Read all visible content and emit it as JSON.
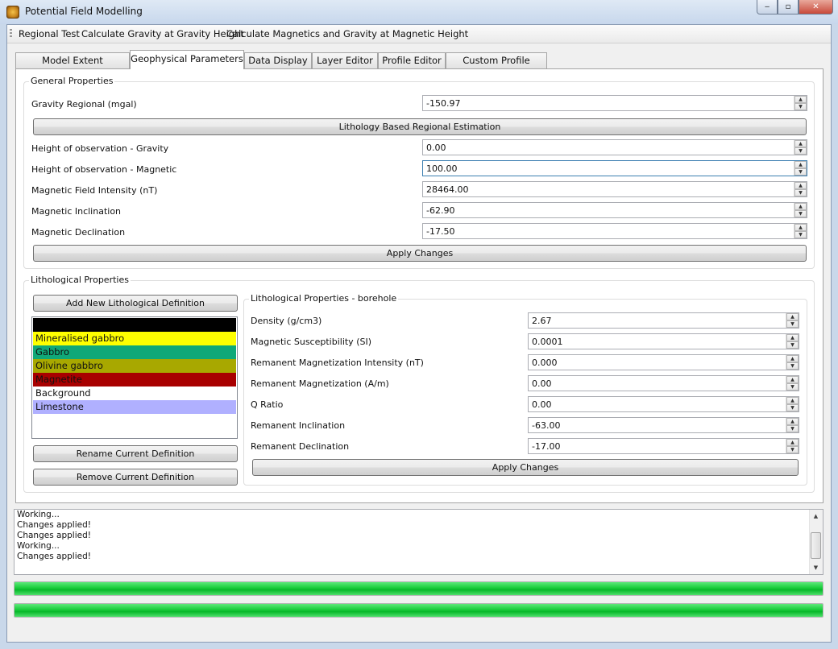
{
  "window": {
    "title": "Potential Field Modelling",
    "minimize_symbol": "‒",
    "maximize_symbol": "▫",
    "close_symbol": "✕"
  },
  "menubar": {
    "items": [
      "Regional Test",
      "Calculate Gravity at Gravity Height",
      "Calculate Magnetics and Gravity at Magnetic Height"
    ]
  },
  "tabs": [
    "Model Extent Parameters",
    "Geophysical Parameters",
    "Data Display",
    "Layer Editor",
    "Profile Editor",
    "Custom Profile Viewer"
  ],
  "active_tab": "Geophysical Parameters",
  "general": {
    "title": "General Properties",
    "gravity_regional": {
      "label": "Gravity Regional (mgal)",
      "value": "-150.97"
    },
    "estimation_button": "Lithology Based Regional Estimation",
    "height_gravity": {
      "label": "Height of observation - Gravity",
      "value": "0.00"
    },
    "height_magnetic": {
      "label": "Height of observation - Magnetic",
      "value": "100.00"
    },
    "field_intensity": {
      "label": "Magnetic Field Intensity (nT)",
      "value": "28464.00"
    },
    "inclination": {
      "label": "Magnetic Inclination",
      "value": "-62.90"
    },
    "declination": {
      "label": "Magnetic Declination",
      "value": "-17.50"
    },
    "apply_button": "Apply Changes"
  },
  "lithological": {
    "title": "Lithological Properties",
    "add_button": "Add New Lithological Definition",
    "definitions": [
      {
        "name": "",
        "color": "#000000",
        "text_color": "#ffffff"
      },
      {
        "name": "Mineralised gabbro",
        "color": "#ffff00",
        "text_color": "#111111"
      },
      {
        "name": "Gabbro",
        "color": "#10a878",
        "text_color": "#111111"
      },
      {
        "name": "Olivine gabbro",
        "color": "#a8a800",
        "text_color": "#111111"
      },
      {
        "name": "Magnetite",
        "color": "#a80000",
        "text_color": "#111111"
      },
      {
        "name": "Background",
        "color": "#ffffff",
        "text_color": "#111111"
      },
      {
        "name": "Limestone",
        "color": "#b0b0ff",
        "text_color": "#111111"
      }
    ],
    "rename_button": "Rename Current Definition",
    "remove_button": "Remove Current Definition",
    "borehole": {
      "title": "Lithological Properties - borehole",
      "density": {
        "label": "Density (g/cm3)",
        "value": "2.67"
      },
      "susceptibility": {
        "label": "Magnetic Susceptibility (SI)",
        "value": "0.0001"
      },
      "rem_intensity": {
        "label": "Remanent Magnetization Intensity (nT)",
        "value": "0.000"
      },
      "rem_am": {
        "label": "Remanent Magnetization (A/m)",
        "value": "0.00"
      },
      "q_ratio": {
        "label": "Q Ratio",
        "value": "0.00"
      },
      "rem_inclination": {
        "label": "Remanent Inclination",
        "value": "-63.00"
      },
      "rem_declination": {
        "label": "Remanent Declination",
        "value": "-17.00"
      },
      "apply_button": "Apply Changes"
    }
  },
  "log": {
    "lines": [
      "Working...",
      "Changes applied!",
      "Changes applied!",
      "Working...",
      "Changes applied!"
    ]
  },
  "progress": {
    "bar1": 1.0,
    "bar2": 1.0,
    "color": "#20d041"
  }
}
